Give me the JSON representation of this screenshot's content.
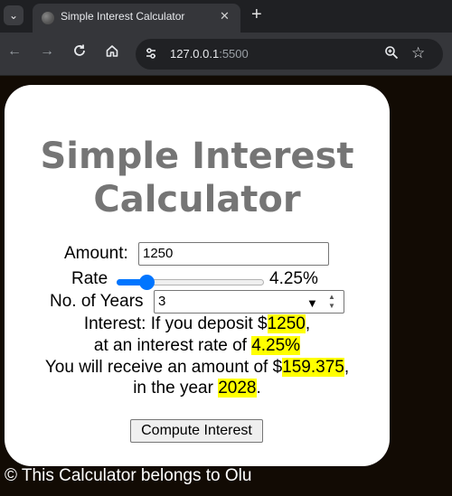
{
  "browser": {
    "tab_title": "Simple Interest Calculator",
    "url_host": "127.0.0.1",
    "url_port": ":5500"
  },
  "calculator": {
    "title_line1": "Simple Interest",
    "title_line2": "Calculator",
    "amount_label": "Amount:",
    "amount_value": "1250",
    "rate_label": "Rate",
    "rate_value": 4.25,
    "rate_display": "4.25%",
    "rate_range": [
      1,
      20
    ],
    "years_label": "No. of Years",
    "years_value": "3",
    "result": {
      "line1_prefix": "Interest: If you deposit $",
      "deposit": "1250",
      "line1_suffix": ",",
      "line2_prefix": "at an interest rate of",
      "rate": "4.25%",
      "line3_prefix": "You will receive an amount of $",
      "amount": "159.375",
      "line3_suffix": ",",
      "line4_prefix": "in the year",
      "year": "2028",
      "line4_suffix": "."
    },
    "compute_button": "Compute Interest"
  },
  "footer": {
    "text": "© This Calculator belongs to Olu"
  },
  "colors": {
    "highlight": "#ffff00",
    "slider_accent": "#0075ff",
    "title_gray": "#757575"
  },
  "icons": [
    "tab-menu-icon",
    "globe-icon",
    "close-icon",
    "plus-icon",
    "back-icon",
    "forward-icon",
    "reload-icon",
    "home-icon",
    "site-info-icon",
    "zoom-icon",
    "star-icon"
  ]
}
